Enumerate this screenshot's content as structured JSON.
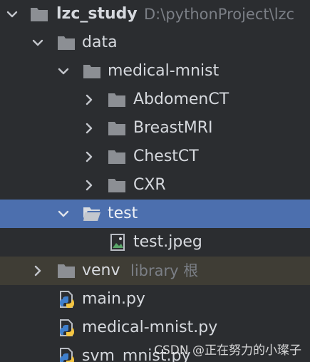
{
  "tree": {
    "root": {
      "label": "lzc_study",
      "path": "D:\\pythonProject\\lzc"
    },
    "items": [
      {
        "label": "data"
      },
      {
        "label": "medical-mnist"
      },
      {
        "label": "AbdomenCT"
      },
      {
        "label": "BreastMRI"
      },
      {
        "label": "ChestCT"
      },
      {
        "label": "CXR"
      },
      {
        "label": "test"
      },
      {
        "label": "test.jpeg"
      },
      {
        "label": "venv",
        "suffix": "library 根"
      },
      {
        "label": "main.py"
      },
      {
        "label": "medical-mnist.py"
      },
      {
        "label": "svm_mnist.py"
      }
    ]
  },
  "watermark": "CSDN @正在努力的小璨子",
  "colors": {
    "background": "#2b2d30",
    "selected": "#4c6fae",
    "excluded_row": "#3f3d35",
    "folder": "#8c8f94",
    "text": "#d6d9de"
  }
}
